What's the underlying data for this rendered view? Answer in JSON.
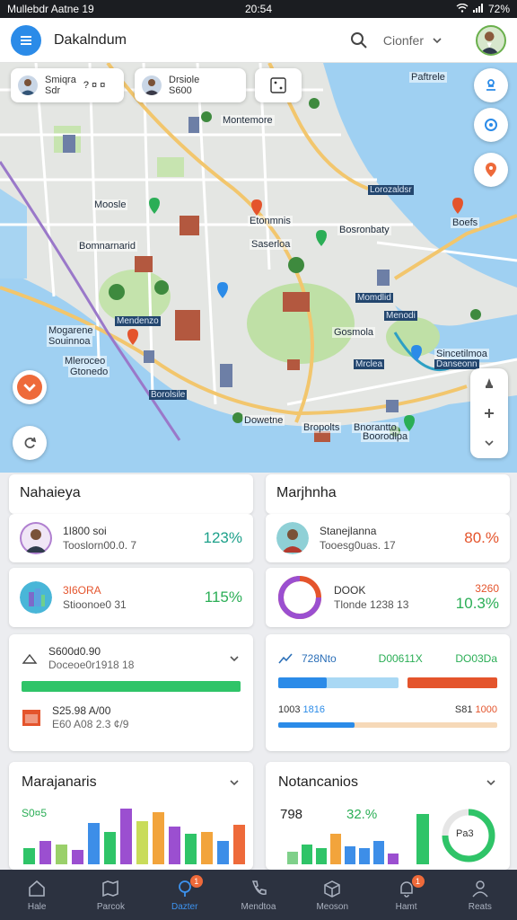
{
  "status_bar": {
    "left": "Mullebdr Aatne 19",
    "time": "20:54",
    "battery": "72%"
  },
  "app_bar": {
    "title": "Dakalndum",
    "filter_label": "Cionfer"
  },
  "map": {
    "chips": [
      {
        "line1": "Smiqra",
        "line2": "Sdr",
        "extra": "? ¤ ¤"
      },
      {
        "line1": "Drsiole",
        "line2": "S600"
      }
    ],
    "labels": [
      "Montemore",
      "Lorozaldsr",
      "Moosle",
      "Etonmnis",
      "Bosronbaty",
      "Bomnarnarid",
      "Saserloa",
      "Mogarene",
      "Mendenzo",
      "Gosmola",
      "Momdlid",
      "Mleroceo",
      "Dowetne",
      "Bropolts",
      "Menodi",
      "Mrclea",
      "Souinnoa",
      "Sincetilmoa",
      "Gtonedo",
      "Borolsile",
      "Boefs",
      "Paftrele",
      "Bnorantto",
      "Boorodlpa",
      "Danseonn"
    ]
  },
  "cards": {
    "left_header": "Nahaieya",
    "right_header": "Marjhnha",
    "metric_1": {
      "line1": "1I800 soi",
      "line2": "Tooslorn00.0. 7",
      "pct": "123%"
    },
    "metric_2": {
      "line1": "3I6ORA",
      "line2": "Stioonoe0 31",
      "pct": "115%"
    },
    "metric_3": {
      "line1": "Stanejlanna",
      "line2": "Tooesg0uas. 17",
      "pct": "80.%"
    },
    "metric_4": {
      "line1": "DOOK",
      "line2": "Tlonde 1238 13",
      "pct_top": "3260",
      "pct": "10.3%"
    },
    "progress_left": {
      "line1": "S600d0.90",
      "line2": "Doceoe0r1918 18",
      "line3": "S25.98 A/00",
      "line4": "E60 A08 2.3 ¢/9",
      "fill": 1.0
    },
    "progress_right": {
      "label_left": "728Nto",
      "label_mid": "D00611X",
      "label_right": "DO03Da",
      "label_bl": "1003",
      "label_bl2": "1816",
      "label_br": "S81",
      "label_br2": "1000",
      "bar1_fill": 0.4,
      "bar2_fill": 0.35
    },
    "chart_left": {
      "title": "Marajanaris",
      "value_label": "S0¤5"
    },
    "chart_right": {
      "title": "Notancanios",
      "value_label": "798",
      "pct_label": "32.%",
      "donut_label": "Pa3"
    }
  },
  "colors": {
    "accent": "#2b8be8",
    "green": "#2bae56",
    "red": "#e4542c",
    "teal": "#1da08a",
    "nav_bg": "#2c3240"
  },
  "nav": [
    {
      "label": "Hale",
      "icon": "home-icon"
    },
    {
      "label": "Parcok",
      "icon": "map-icon"
    },
    {
      "label": "Dazter",
      "icon": "location-icon",
      "badge": "1"
    },
    {
      "label": "Mendtoa",
      "icon": "phone-icon"
    },
    {
      "label": "Meoson",
      "icon": "box-icon"
    },
    {
      "label": "Hamt",
      "icon": "bell-icon",
      "badge": "1"
    },
    {
      "label": "Reats",
      "icon": "person-icon"
    }
  ]
}
